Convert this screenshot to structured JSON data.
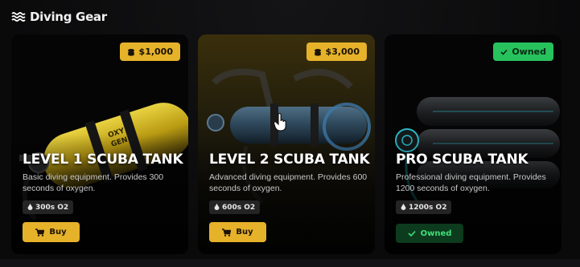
{
  "header": {
    "title": "Diving Gear",
    "icon": "waves-icon"
  },
  "cards": [
    {
      "title": "LEVEL 1 SCUBA TANK",
      "description": "Basic diving equipment. Provides 300 seconds of oxygen.",
      "price": "$1,000",
      "stat": "300s O2",
      "action": "Buy",
      "owned": false,
      "accent": "#e6b22a"
    },
    {
      "title": "LEVEL 2 SCUBA TANK",
      "description": "Advanced diving equipment. Provides 600 seconds of oxygen.",
      "price": "$3,000",
      "stat": "600s O2",
      "action": "Buy",
      "owned": false,
      "accent": "#e6b22a"
    },
    {
      "title": "PRO SCUBA TANK",
      "description": "Professional diving equipment. Provides 1200 seconds of oxygen.",
      "badge": "Owned",
      "stat": "1200s O2",
      "action": "Owned",
      "owned": true,
      "accent": "#27c25d"
    }
  ],
  "colors": {
    "gold": "#e6b22a",
    "green": "#27c25d",
    "background": "#0b0b0c"
  }
}
